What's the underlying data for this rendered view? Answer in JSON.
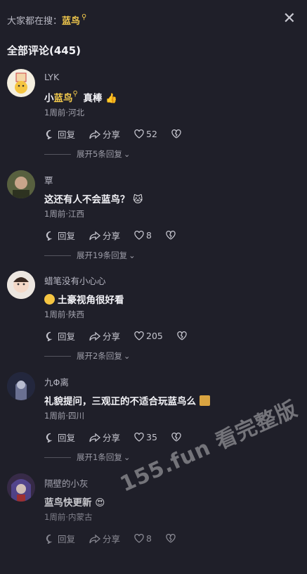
{
  "search_bar": {
    "prefix": "大家都在搜：",
    "keyword": "蓝鸟",
    "search_icon": "search-icon"
  },
  "close_icon": "close-icon",
  "section_title": "全部评论(445)",
  "comments": [
    {
      "username": "LYK",
      "text_prefix": "小",
      "text_keyword": "蓝鸟",
      "text_suffix": " 真棒",
      "emoji": "thumbs-up",
      "meta": "1周前·河北",
      "reply_label": "回复",
      "share_label": "分享",
      "like_count": "52",
      "expand_label": "展开5条回复"
    },
    {
      "username": "覃",
      "text": "这还有人不会蓝鸟？",
      "emoji": "cat-face",
      "meta": "1周前·江西",
      "reply_label": "回复",
      "share_label": "分享",
      "like_count": "8",
      "expand_label": "展开19条回复"
    },
    {
      "username": "蜡笔没有小心心",
      "text": "土豪视角很好看",
      "emoji": "face-emoji",
      "meta": "1周前·陕西",
      "reply_label": "回复",
      "share_label": "分享",
      "like_count": "205",
      "expand_label": "展开2条回复"
    },
    {
      "username": "九Φ离",
      "text": "礼貌提问，三观正的不适合玩蓝鸟么",
      "emoji": "sticker",
      "meta": "1周前·四川",
      "reply_label": "回复",
      "share_label": "分享",
      "like_count": "35",
      "expand_label": "展开1条回复"
    },
    {
      "username": "隔壁的小灰",
      "text": "蓝鸟快更新",
      "emoji": "heart-eyes",
      "meta": "1周前·内蒙古",
      "reply_label": "回复",
      "share_label": "分享",
      "like_count": "8"
    }
  ],
  "watermark": "155.fun 看完整版",
  "colors": {
    "background": "#1f1f29",
    "keyword": "#f2c94c"
  }
}
